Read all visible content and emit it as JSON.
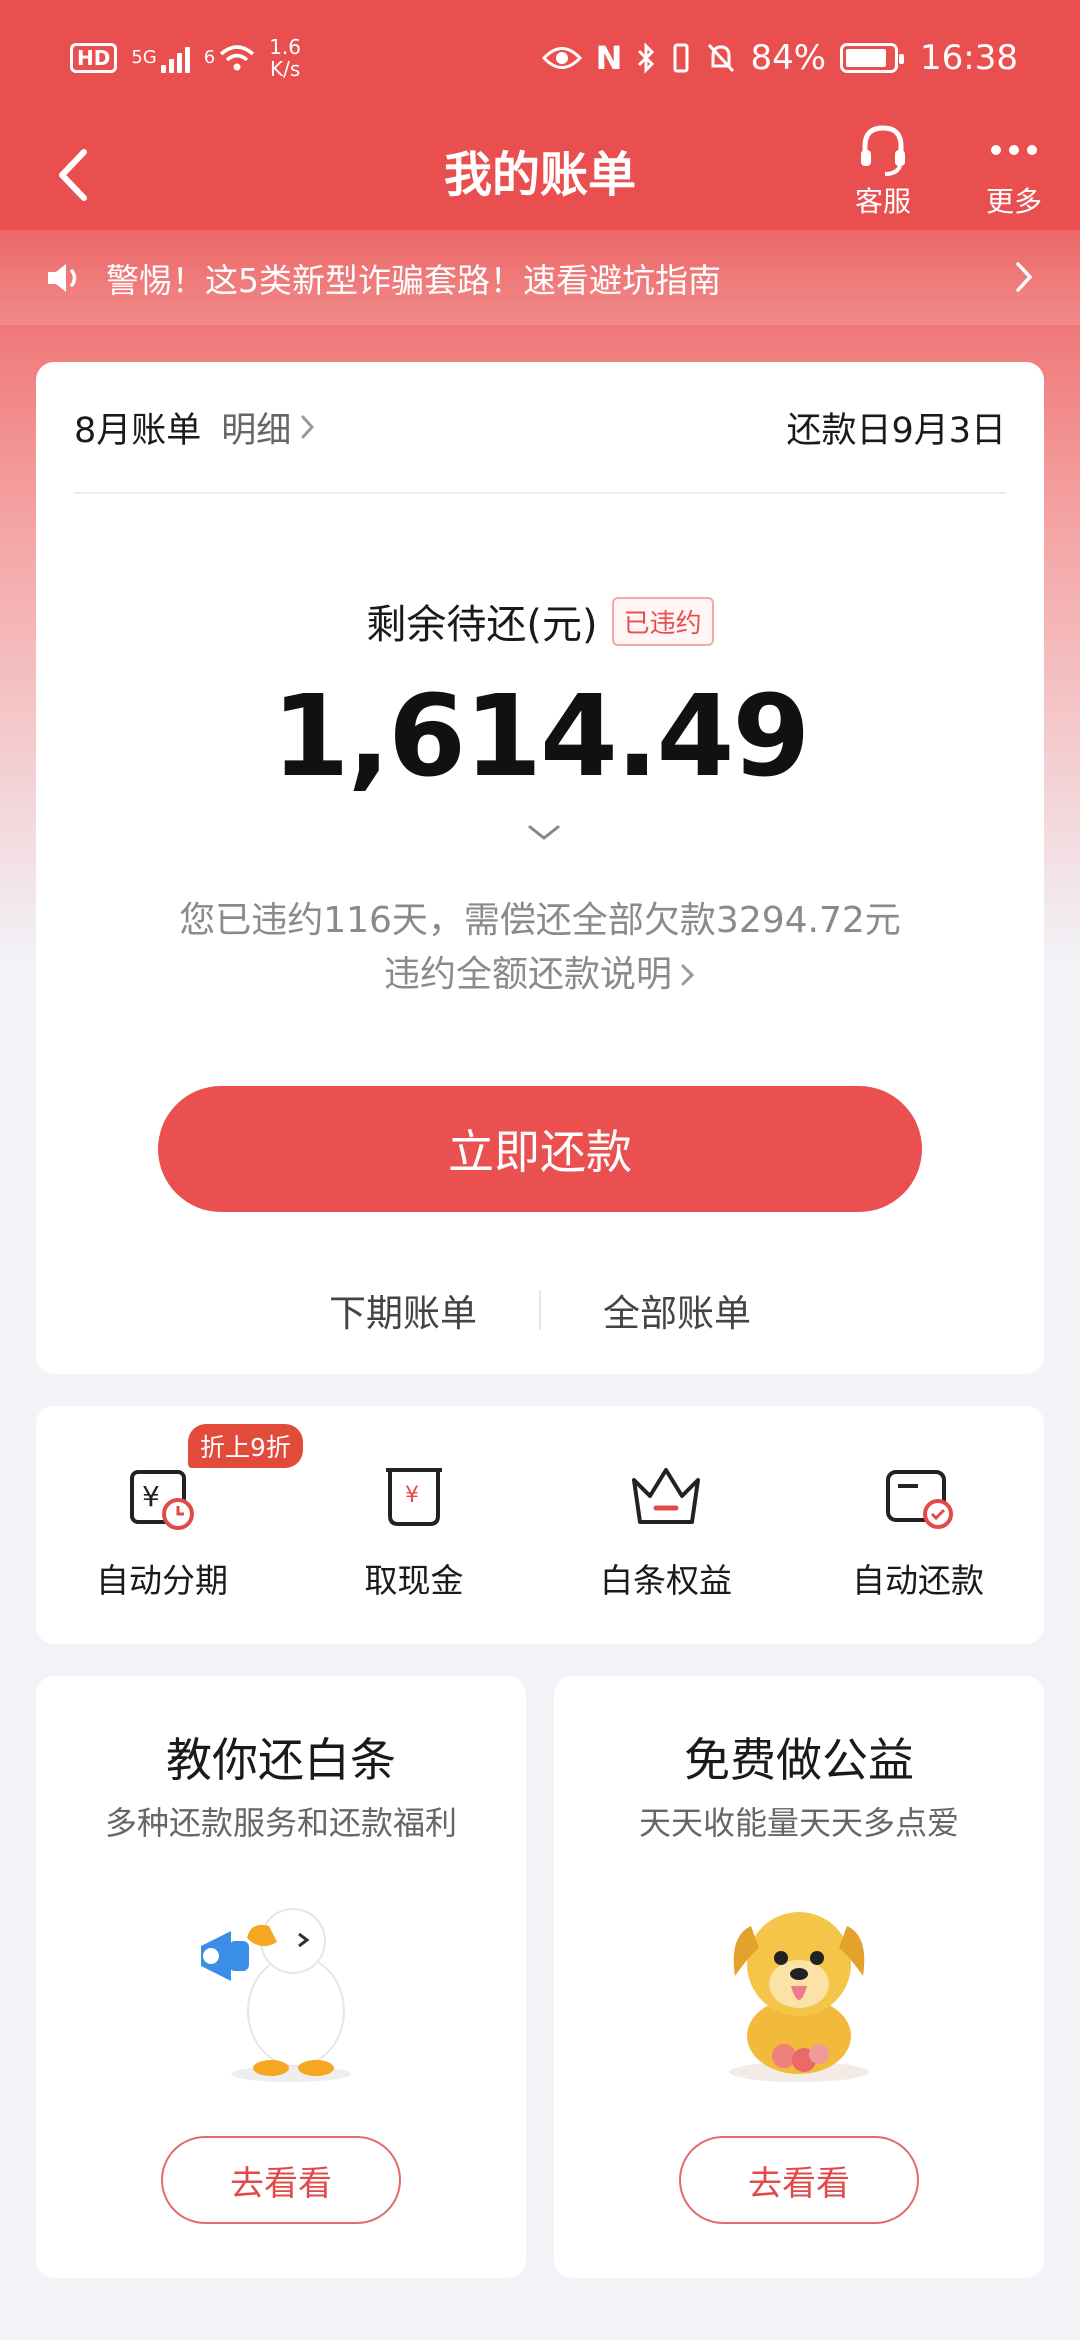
{
  "status_bar": {
    "hd": "HD",
    "network": "5G",
    "wifi_tag": "6",
    "speed_value": "1.6",
    "speed_unit": "K/s",
    "nfc": "N",
    "battery_percent": "84%",
    "time": "16:38"
  },
  "nav": {
    "title": "我的账单",
    "service_label": "客服",
    "more_label": "更多"
  },
  "notice": {
    "text": "警惕！这5类新型诈骗套路！速看避坑指南"
  },
  "bill": {
    "month_label": "8月账单",
    "detail_label": "明细",
    "due_label": "还款日9月3日",
    "remaining_label": "剩余待还(元)",
    "status_tag": "已违约",
    "amount": "1,614.49",
    "overdue_message": "您已违约116天，需偿还全部欠款3294.72元",
    "overdue_link": "违约全额还款说明",
    "pay_button": "立即还款",
    "next_bill_label": "下期账单",
    "all_bills_label": "全部账单"
  },
  "quick_actions": [
    {
      "label": "自动分期",
      "icon": "installment-icon",
      "badge": "折上9折"
    },
    {
      "label": "取现金",
      "icon": "cash-icon"
    },
    {
      "label": "白条权益",
      "icon": "crown-icon"
    },
    {
      "label": "自动还款",
      "icon": "auto-repay-icon"
    }
  ],
  "promos": [
    {
      "title": "教你还白条",
      "subtitle": "多种还款服务和还款福利",
      "button": "去看看",
      "art": "duck-megaphone-illustration"
    },
    {
      "title": "免费做公益",
      "subtitle": "天天收能量天天多点爱",
      "button": "去看看",
      "art": "dog-mascot-illustration"
    }
  ],
  "colors": {
    "brand_red": "#ea4f4f",
    "button_red": "#ea5050",
    "page_bg": "#f2f2f7"
  }
}
